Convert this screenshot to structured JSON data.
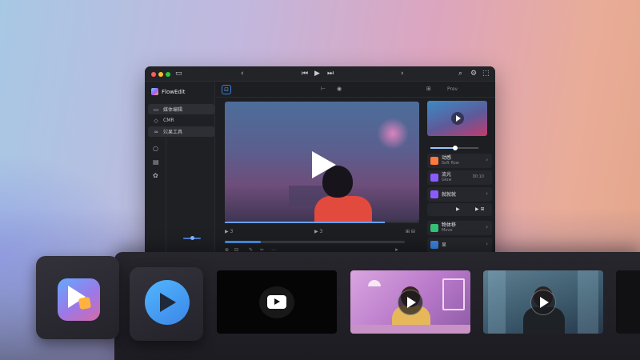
{
  "app": {
    "name": "FlowEdit"
  },
  "sidebar": {
    "items": [
      {
        "label": "媒体编辑",
        "icon": "media-icon"
      },
      {
        "label": "CMR",
        "icon": "tag-icon"
      },
      {
        "label": "效果工具",
        "icon": "effects-icon"
      }
    ],
    "rail_icons": [
      "circle-icon",
      "document-icon",
      "settings-icon"
    ]
  },
  "toolbar": {
    "label": "Prev"
  },
  "transport": {
    "left": "▶ 3",
    "center": "▶ 3",
    "right": "⊞ ⊟"
  },
  "panel": {
    "rows": [
      {
        "title": "动感",
        "sub": "Soft flow",
        "chip_color": "#ff7a3d"
      },
      {
        "title": "流光",
        "sub": "Glow",
        "right": "00:10",
        "chip_color": "#8a5cff"
      },
      {
        "title": "就就就",
        "sub": "",
        "chip_color": "#8a5cff"
      },
      {
        "title": "物体移",
        "sub": "Move",
        "chip_color": "#36c275"
      },
      {
        "title": "显",
        "sub": "",
        "chip_color": "#3b86e6"
      }
    ],
    "controls": {
      "play": "▶",
      "right": "▶ ⊞"
    },
    "slider_value": 0.5
  },
  "colors": {
    "accent": "#4a8fe8",
    "window_bg": "#1d1e22"
  },
  "shelf": {
    "apps": [
      {
        "name": "app-tile-editor",
        "icon": "play-square-icon"
      },
      {
        "name": "app-tile-player",
        "icon": "play-circle-icon"
      }
    ],
    "clips": [
      "clip-dark",
      "clip-room",
      "clip-city",
      "clip-partial"
    ]
  }
}
